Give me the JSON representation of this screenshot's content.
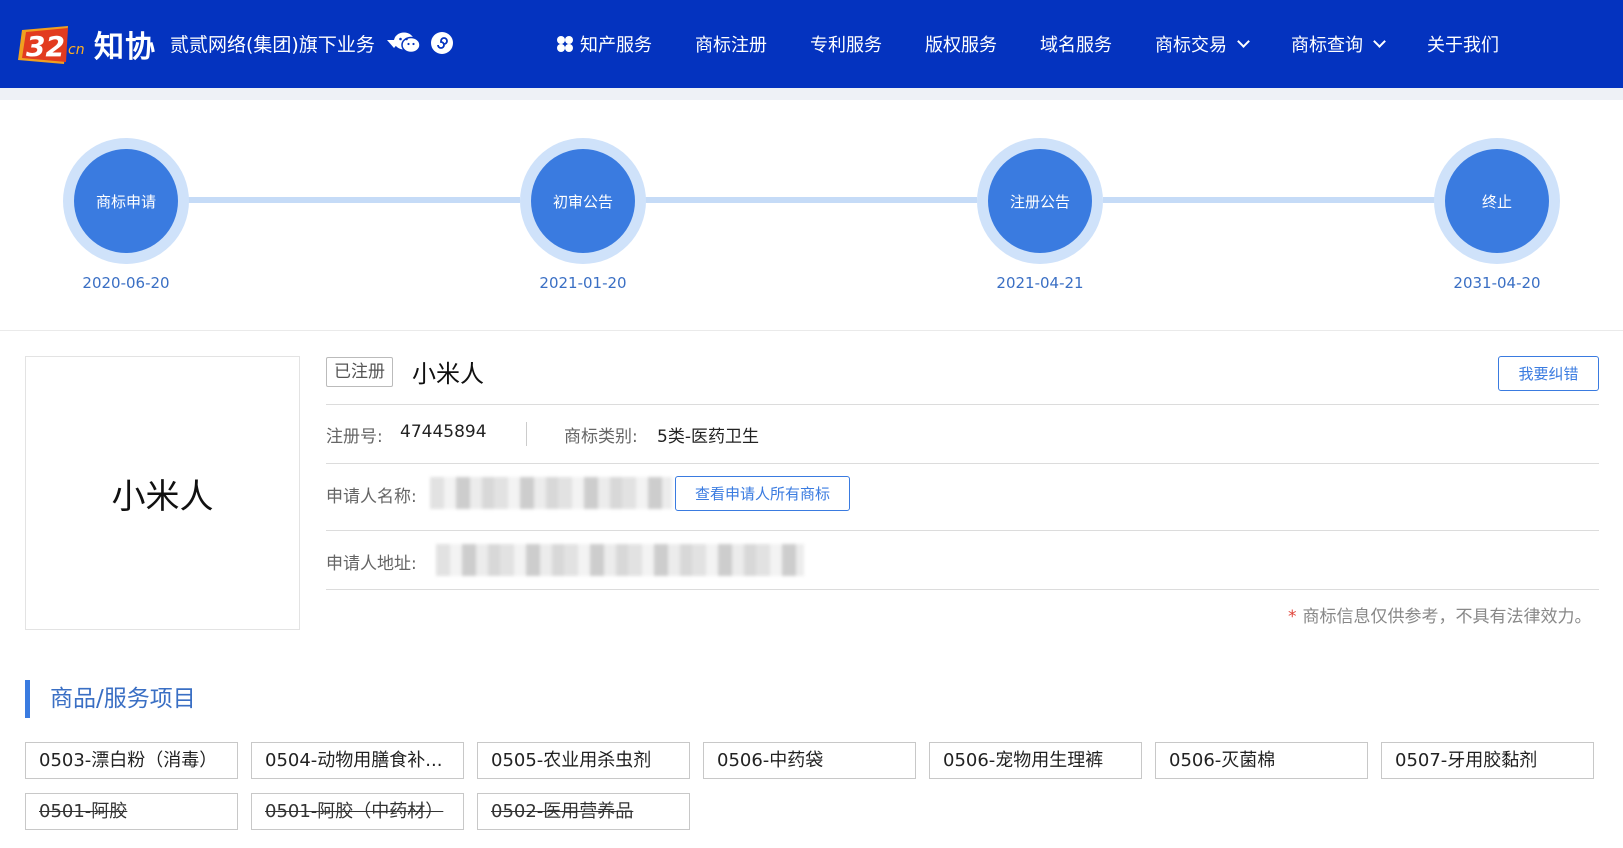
{
  "header": {
    "logo_text": "知协",
    "group_label": "贰贰网络(集团)旗下业务",
    "menu": [
      {
        "label": "知产服务",
        "dropdown": false
      },
      {
        "label": "商标注册",
        "dropdown": false
      },
      {
        "label": "专利服务",
        "dropdown": false
      },
      {
        "label": "版权服务",
        "dropdown": false
      },
      {
        "label": "域名服务",
        "dropdown": false
      },
      {
        "label": "商标交易",
        "dropdown": true
      },
      {
        "label": "商标查询",
        "dropdown": true
      },
      {
        "label": "关于我们",
        "dropdown": false
      }
    ]
  },
  "timeline": [
    {
      "label": "商标申请",
      "date": "2020-06-20"
    },
    {
      "label": "初审公告",
      "date": "2021-01-20"
    },
    {
      "label": "注册公告",
      "date": "2021-04-21"
    },
    {
      "label": "终止",
      "date": "2031-04-20"
    }
  ],
  "trademark": {
    "image_text": "小米人",
    "status": "已注册",
    "name": "小米人",
    "correct_label": "我要纠错",
    "reg_no_label": "注册号:",
    "reg_no": "47445894",
    "category_label": "商标类别:",
    "category": "5类-医药卫生",
    "applicant_label": "申请人名称:",
    "view_all_label": "查看申请人所有商标",
    "address_label": "申请人地址:",
    "disclaimer_star": "*",
    "disclaimer": "商标信息仅供参考，不具有法律效力。"
  },
  "goods": {
    "title": "商品/服务项目",
    "items": [
      {
        "text": "0503-漂白粉（消毒）",
        "deleted": false
      },
      {
        "text": "0504-动物用膳食补...",
        "deleted": false
      },
      {
        "text": "0505-农业用杀虫剂",
        "deleted": false
      },
      {
        "text": "0506-中药袋",
        "deleted": false
      },
      {
        "text": "0506-宠物用生理裤",
        "deleted": false
      },
      {
        "text": "0506-灭菌棉",
        "deleted": false
      },
      {
        "text": "0507-牙用胶黏剂",
        "deleted": false
      },
      {
        "text": "0501-阿胶",
        "deleted": true
      },
      {
        "text": "0501-阿胶（中药材）",
        "deleted": true
      },
      {
        "text": "0502-医用营养品",
        "deleted": true
      }
    ]
  }
}
